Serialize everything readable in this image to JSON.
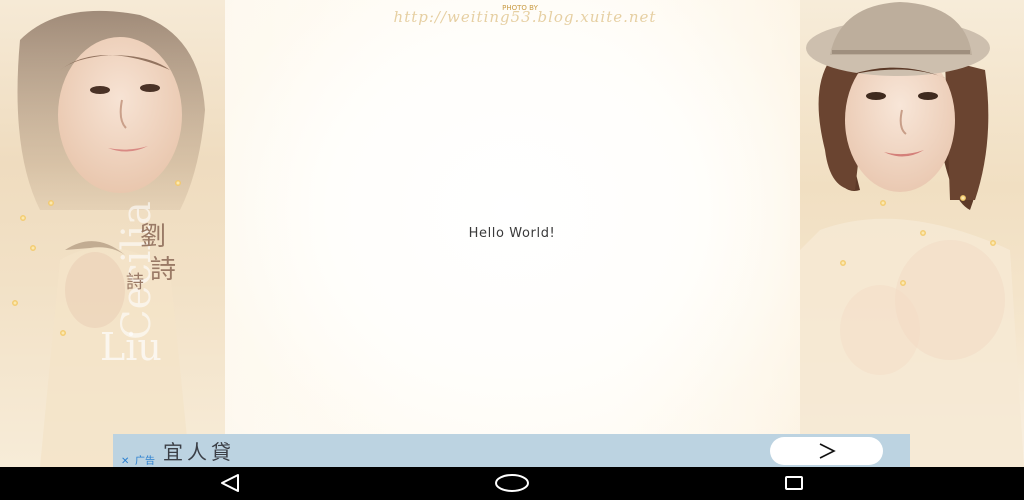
{
  "app": {
    "content_text": "Hello World!"
  },
  "wallpaper": {
    "url_text": "http://weiting53.blog.xuite.net",
    "credit_text": "PHOTO BY",
    "left_caption": "劉詩詩",
    "left_caption_latin": "Cecilia Liu",
    "accent_color": "#f3c968"
  },
  "ad": {
    "title": "宜人貸",
    "close_symbol": "✕",
    "tag_label": "广告",
    "cta_icon": "chevron-right-icon",
    "background_color": "#bcd3e1"
  },
  "navbar": {
    "back_icon": "back-triangle-icon",
    "home_icon": "home-circle-icon",
    "recents_icon": "recents-square-icon"
  }
}
